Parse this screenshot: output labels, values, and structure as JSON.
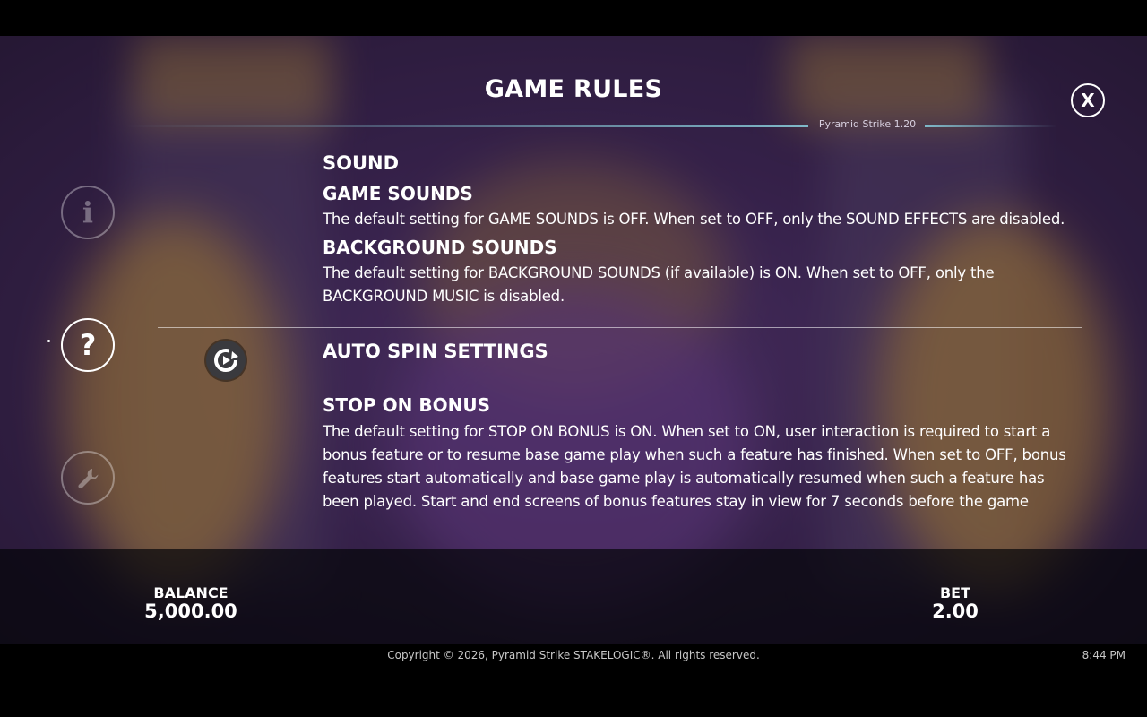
{
  "header": {
    "title": "GAME RULES",
    "version": "Pyramid Strike 1.20",
    "close_label": "X"
  },
  "sidebar": {
    "items": [
      {
        "name": "info",
        "glyph": "i",
        "active": false
      },
      {
        "name": "help",
        "glyph": "?",
        "active": true
      },
      {
        "name": "settings",
        "glyph": "⚒",
        "active": false
      }
    ]
  },
  "rules": {
    "sound": {
      "heading": "SOUND",
      "game_sounds_heading": "GAME SOUNDS",
      "game_sounds_text": "The default setting for GAME SOUNDS is OFF. When set to OFF, only the SOUND EFFECTS are disabled.",
      "background_sounds_heading": "BACKGROUND SOUNDS",
      "background_sounds_text": "The default setting for BACKGROUND SOUNDS (if available) is ON. When set to OFF, only the BACKGROUND MUSIC is disabled."
    },
    "auto_spin": {
      "heading": "AUTO SPIN SETTINGS",
      "stop_on_bonus_heading": "STOP ON BONUS",
      "stop_on_bonus_text": "The default setting for STOP ON BONUS is ON. When set to ON, user interaction is required to start a bonus feature or to resume base game play when such a feature has finished. When set to OFF, bonus features start automatically and base game play is automatically resumed when such a feature has been played. Start and end screens of bonus features stay in view for 7 seconds before the game"
    }
  },
  "bottom_bar": {
    "balance_label": "BALANCE",
    "balance_value": "5,000.00",
    "bet_label": "BET",
    "bet_value": "2.00"
  },
  "footer": {
    "copyright": "Copyright © 2026, Pyramid Strike STAKELOGIC®. All rights reserved.",
    "time": "8:44 PM"
  },
  "colors": {
    "accent_line": "#7fb9c9",
    "text": "#ffffff"
  },
  "icons": {
    "close": "close-icon",
    "info": "info-icon",
    "help": "question-mark-icon",
    "settings": "wrench-icon",
    "auto_spin": "auto-spin-icon"
  }
}
